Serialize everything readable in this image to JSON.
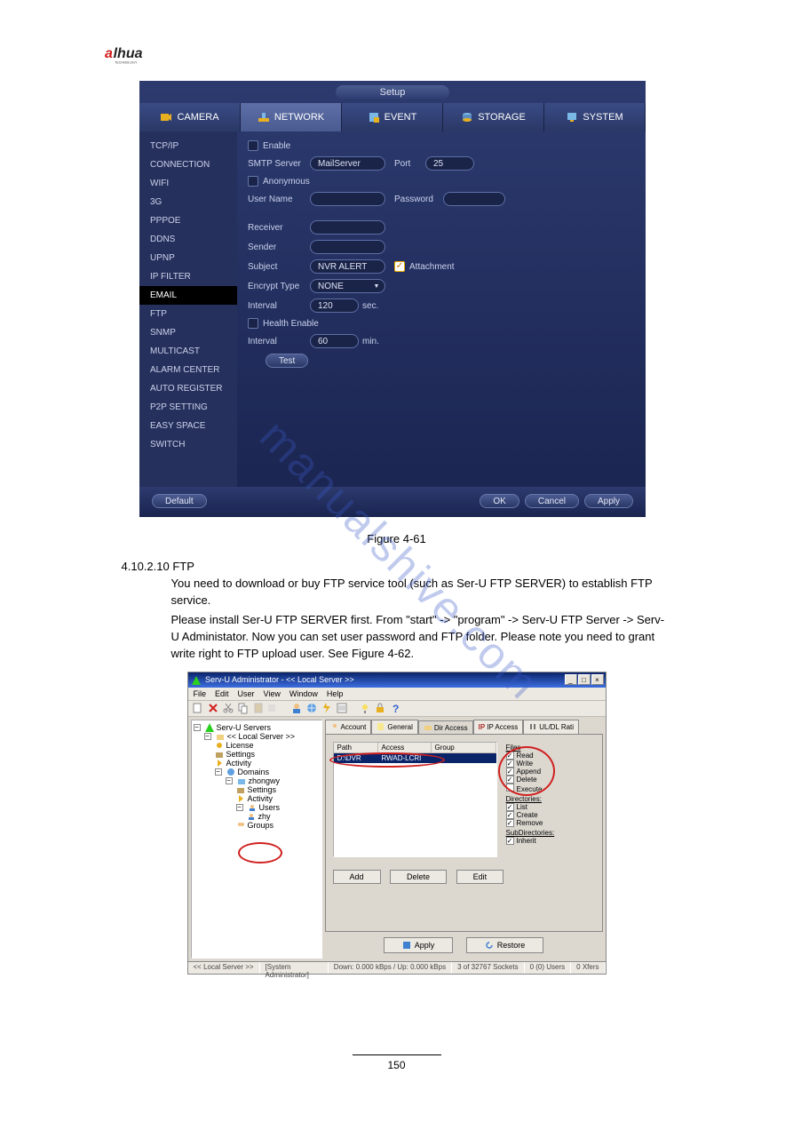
{
  "logo_text": "alhua",
  "logo_sub": "TECHNOLOGY",
  "watermark": "manualshive.com",
  "setup": {
    "title": "Setup",
    "tabs": [
      "CAMERA",
      "NETWORK",
      "EVENT",
      "STORAGE",
      "SYSTEM"
    ],
    "active_tab": "NETWORK",
    "sidebar": [
      "TCP/IP",
      "CONNECTION",
      "WIFI",
      "3G",
      "PPPOE",
      "DDNS",
      "UPNP",
      "IP FILTER",
      "EMAIL",
      "FTP",
      "SNMP",
      "MULTICAST",
      "ALARM CENTER",
      "AUTO REGISTER",
      "P2P SETTING",
      "EASY SPACE",
      "SWITCH"
    ],
    "sidebar_selected": "EMAIL",
    "labels": {
      "enable": "Enable",
      "smtp_server": "SMTP Server",
      "port": "Port",
      "anonymous": "Anonymous",
      "user_name": "User Name",
      "password": "Password",
      "receiver": "Receiver",
      "sender": "Sender",
      "subject": "Subject",
      "encrypt": "Encrypt Type",
      "interval1": "Interval",
      "health": "Health Enable",
      "interval2": "Interval",
      "attachment": "Attachment",
      "sec": "sec.",
      "min": "min."
    },
    "values": {
      "smtp_server": "MailServer",
      "port": "25",
      "user_name": "",
      "password": "",
      "receiver": "",
      "sender": "",
      "subject": "NVR ALERT",
      "encrypt": "NONE",
      "interval1": "120",
      "interval2": "60",
      "attachment_checked": true,
      "enable_checked": false,
      "anonymous_checked": false,
      "health_checked": false
    },
    "buttons": {
      "test": "Test",
      "default": "Default",
      "ok": "OK",
      "cancel": "Cancel",
      "apply": "Apply"
    }
  },
  "doc": {
    "fig_caption": "Figure 4-61",
    "heading": "4.10.2.10  FTP",
    "intro": "You need to download or buy FTP service tool (such as Ser-U FTP SERVER) to establish FTP service.",
    "intro2": "Please install Ser-U FTP SERVER first. From \"start\" -> \"program\" -> Serv-U FTP Server -> Serv-U Administator. Now you can set user password and FTP folder. Please note you need to grant write right to FTP upload user. See Figure 4-62."
  },
  "servu": {
    "title_prefix": "Serv-U Administrator - ",
    "title_suffix": "<< Local Server >>",
    "menubar": [
      "File",
      "Edit",
      "User",
      "View",
      "Window",
      "Help"
    ],
    "tree": {
      "root": "Serv-U Servers",
      "local": "<< Local Server >>",
      "license": "License",
      "settings": "Settings",
      "activity": "Activity",
      "domains": "Domains",
      "domain_name": "zhongwy",
      "dsettings": "Settings",
      "dactivity": "Activity",
      "users": "Users",
      "user1": "zhy",
      "groups": "Groups"
    },
    "tabs": [
      "Account",
      "General",
      "Dir Access",
      "IP Access",
      "UL/DL Rati"
    ],
    "active_tab": "Dir Access",
    "list": {
      "headers": [
        "Path",
        "Access",
        "Group"
      ],
      "row": [
        "D:\\DVR",
        "RWAD-LCRI",
        ""
      ]
    },
    "props": {
      "files": "Files",
      "read": "Read",
      "write": "Write",
      "append": "Append",
      "delete": "Delete",
      "execute": "Execute",
      "directories": "Directories:",
      "list": "List",
      "create": "Create",
      "remove": "Remove",
      "subdirectories": "SubDirectories:",
      "inherit": "Inherit"
    },
    "buttons": {
      "add": "Add",
      "delete": "Delete",
      "edit": "Edit",
      "apply": "Apply",
      "restore": "Restore"
    },
    "status": [
      "<< Local Server >>",
      "[System Administrator]",
      "Down: 0.000 kBps / Up: 0.000 kBps",
      "3 of 32767 Sockets",
      "0 (0) Users",
      "0 Xfers"
    ]
  },
  "footer": {
    "page": "150"
  }
}
